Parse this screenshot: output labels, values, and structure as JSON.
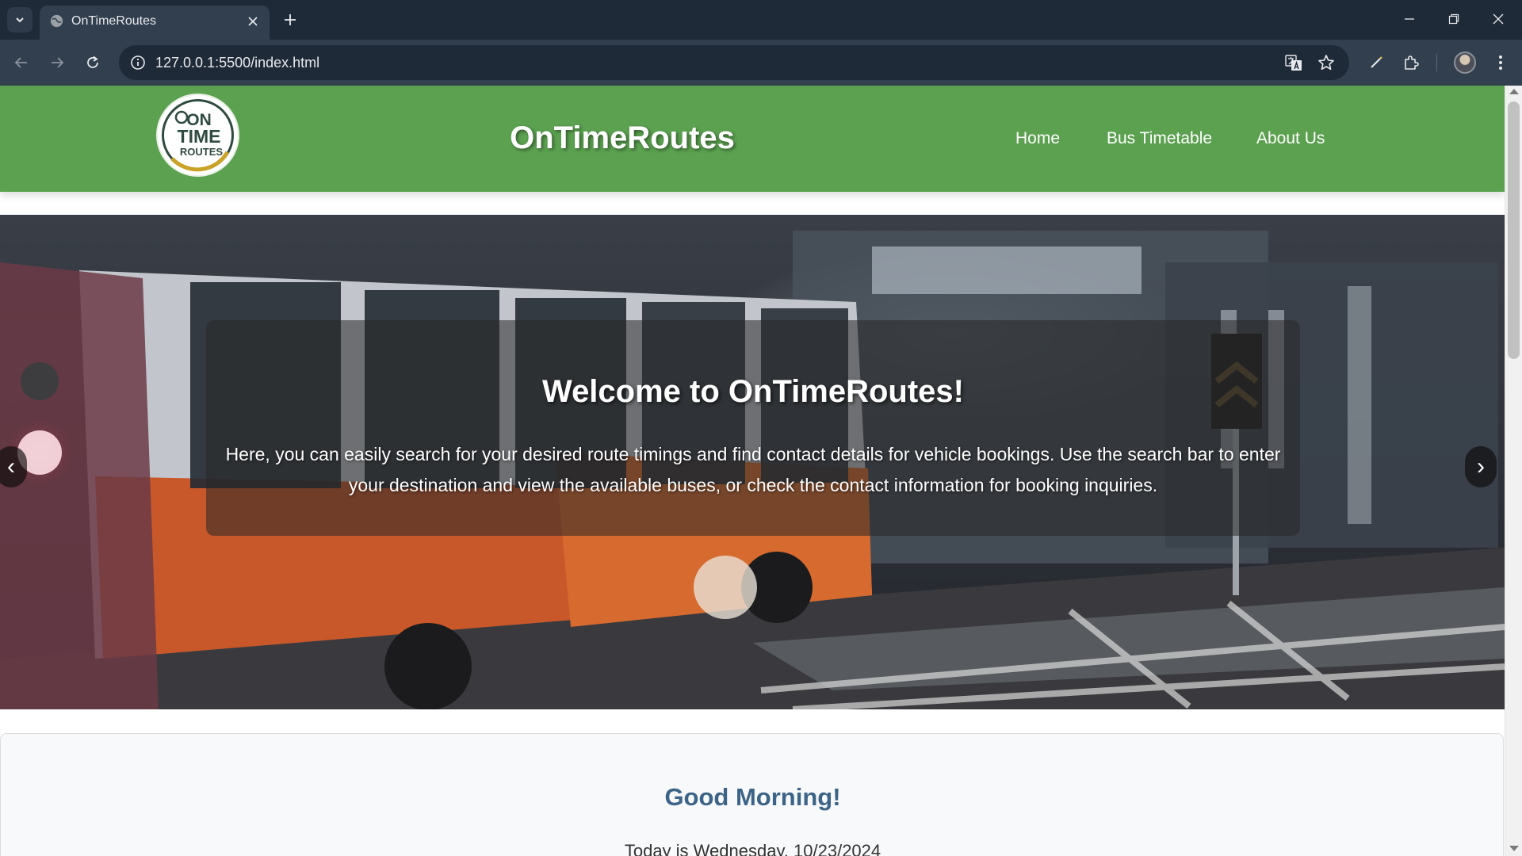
{
  "browser": {
    "tab_title": "OnTimeRoutes",
    "url": "127.0.0.1:5500/index.html"
  },
  "site": {
    "brand": "OnTimeRoutes",
    "logo_text": [
      "ON",
      "TIME",
      "ROUTES"
    ],
    "nav": [
      {
        "label": "Home"
      },
      {
        "label": "Bus Timetable"
      },
      {
        "label": "About Us"
      }
    ],
    "header_color": "#5ba150"
  },
  "hero": {
    "title": "Welcome to OnTimeRoutes!",
    "text": "Here, you can easily search for your desired route timings and find contact details for vehicle bookings. Use the search bar to enter your destination and view the available buses, or check the contact information for booking inquiries.",
    "prev_label": "‹",
    "next_label": "›"
  },
  "greeting": {
    "title": "Good Morning!",
    "date_text": "Today is Wednesday, 10/23/2024",
    "title_color": "#3c6488"
  }
}
